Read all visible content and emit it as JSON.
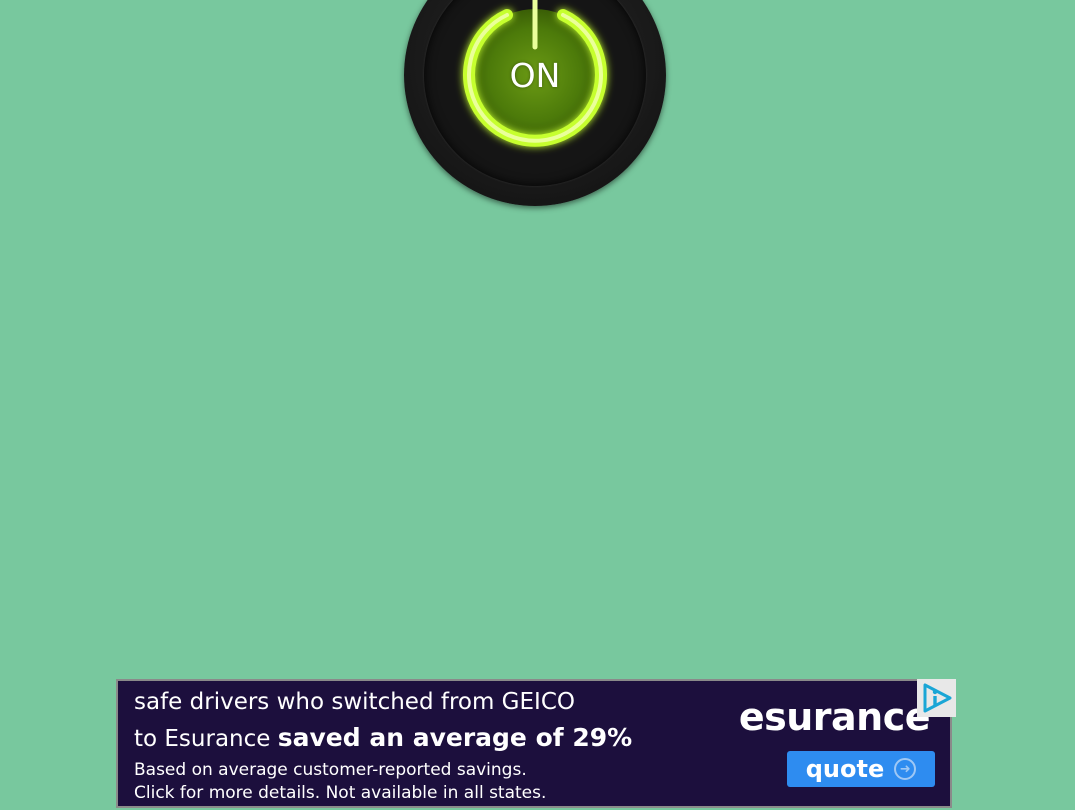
{
  "power": {
    "label": "ON",
    "state": "on",
    "glow_color": "#b8ff2a",
    "icon": "power-icon"
  },
  "ad": {
    "line1": "safe drivers who switched from GEICO",
    "line2_prefix": "to Esurance ",
    "line2_bold": "saved an average of 29%",
    "fine1": "Based on average customer-reported savings.",
    "fine2": "Click for more details. Not available in all states.",
    "brand": "esurance",
    "cta_label": "quote",
    "cta_icon": "arrow-right-circle-icon",
    "adchoices_icon": "adchoices-icon",
    "background_color": "#1c0f3d",
    "cta_color": "#2e8cf0"
  },
  "colors": {
    "page_background": "#78c89e"
  }
}
